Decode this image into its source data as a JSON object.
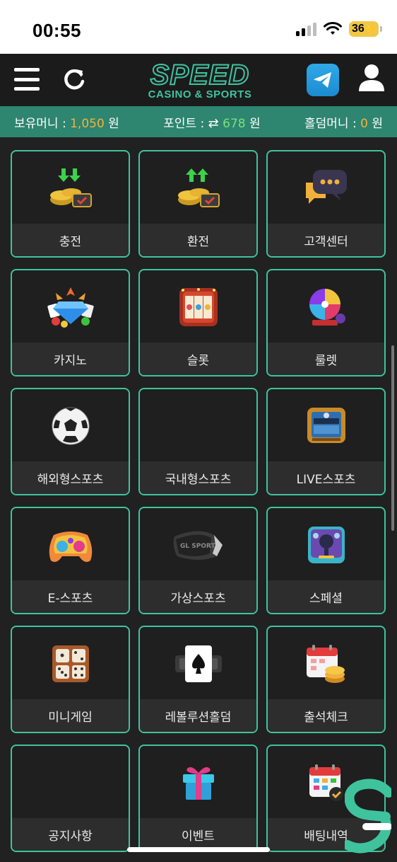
{
  "status": {
    "time": "00:55",
    "battery": "36"
  },
  "header": {
    "logo_main": "SPEED",
    "logo_sub": "CASINO & SPORTS"
  },
  "infobar": {
    "balance_label": "보유머니 : ",
    "balance_value": "1,050",
    "balance_unit": " 원",
    "points_label": "포인트 : ",
    "points_value": "678",
    "points_unit": " 원",
    "holdem_label": "홀덤머니 : ",
    "holdem_value": "0",
    "holdem_unit": " 원"
  },
  "tiles": [
    {
      "label": "충전",
      "icon": "coin-deposit-icon"
    },
    {
      "label": "환전",
      "icon": "coin-withdraw-icon"
    },
    {
      "label": "고객센터",
      "icon": "chat-bubble-icon"
    },
    {
      "label": "카지노",
      "icon": "diamond-casino-icon"
    },
    {
      "label": "슬롯",
      "icon": "slot-machine-icon"
    },
    {
      "label": "룰렛",
      "icon": "roulette-wheel-icon"
    },
    {
      "label": "해외형스포츠",
      "icon": "soccer-ball-icon"
    },
    {
      "label": "국내형스포츠",
      "icon": ""
    },
    {
      "label": "LIVE스포츠",
      "icon": "tv-screen-icon"
    },
    {
      "label": "E-스포츠",
      "icon": "gamepad-icon"
    },
    {
      "label": "가상스포츠",
      "icon": "vr-headset-icon"
    },
    {
      "label": "스페셜",
      "icon": "microphone-icon"
    },
    {
      "label": "미니게임",
      "icon": "dice-board-icon"
    },
    {
      "label": "레볼루션홀덤",
      "icon": "spade-card-icon"
    },
    {
      "label": "출석체크",
      "icon": "calendar-coins-icon"
    },
    {
      "label": "공지사항",
      "icon": ""
    },
    {
      "label": "이벤트",
      "icon": "gift-box-icon"
    },
    {
      "label": "배팅내역",
      "icon": "calendar-check-icon"
    }
  ],
  "colors": {
    "accent": "#3fc39d",
    "infobar": "#2e8570",
    "amount": "#f2b33d",
    "points": "#7be07b"
  }
}
